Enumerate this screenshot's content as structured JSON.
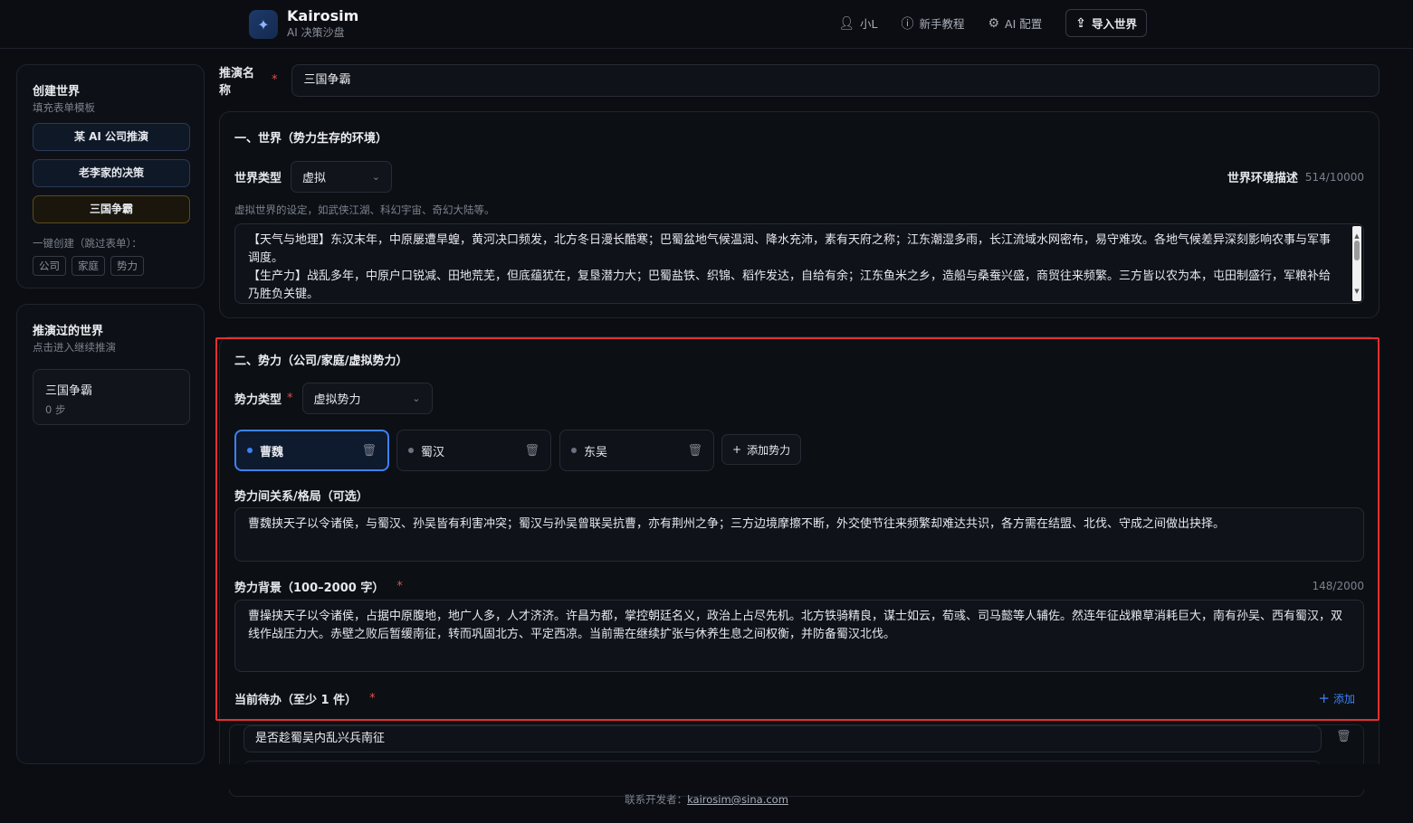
{
  "app": {
    "name": "Kairosim",
    "subtitle": "AI 决策沙盘"
  },
  "nav": {
    "user": "小L",
    "tutorial": "新手教程",
    "ai_config": "AI 配置",
    "import_world": "导入世界"
  },
  "create_card": {
    "title": "创建世界",
    "subtitle": "填充表单模板",
    "templates": [
      "某 AI 公司推演",
      "老李家的决策",
      "三国争霸"
    ],
    "quick_label": "一键创建（跳过表单）：",
    "quick_chips": [
      "公司",
      "家庭",
      "势力"
    ]
  },
  "history_card": {
    "title": "推演过的世界",
    "subtitle": "点击进入继续推演",
    "items": [
      {
        "name": "三国争霸",
        "steps": "0 步"
      }
    ]
  },
  "form": {
    "name_label": "推演名称",
    "name_value": "三国争霸",
    "world": {
      "title": "一、世界（势力生存的环境）",
      "type_label": "世界类型",
      "type_value": "虚拟",
      "env_label": "世界环境描述",
      "env_counter": "514/10000",
      "hint": "虚拟世界的设定，如武侠江湖、科幻宇宙、奇幻大陆等。",
      "env_text_1": "【天气与地理】东汉末年，中原屡遭旱蝗，黄河决口频发，北方冬日漫长酷寒；巴蜀盆地气候温润、降水充沛，素有天府之称；江东潮湿多雨，长江流域水网密布，易守难攻。各地气候差异深刻影响农事与军事调度。",
      "env_text_2": "【生产力】战乱多年，中原户口锐减、田地荒芜，但底蕴犹在，复垦潜力大；巴蜀盐铁、织锦、稻作发达，自给有余；江东鱼米之乡，造船与桑蚕兴盛，商贸往来频繁。三方皆以农为本，屯田制盛行，军粮补给乃胜负关键。"
    },
    "factions": {
      "title": "二、势力（公司/家庭/虚拟势力）",
      "type_label": "势力类型",
      "type_value": "虚拟势力",
      "list": [
        "曹魏",
        "蜀汉",
        "东吴"
      ],
      "add_label": "添加势力",
      "relation_label": "势力间关系/格局（可选）",
      "relation_text": "曹魏挟天子以令诸侯，与蜀汉、孙吴皆有利害冲突；蜀汉与孙吴曾联吴抗曹，亦有荆州之争；三方边境摩擦不断，外交使节往来频繁却难达共识，各方需在结盟、北伐、守成之间做出抉择。",
      "background_label": "势力背景（100–2000 字）",
      "background_counter": "148/2000",
      "background_text": "曹操挟天子以令诸侯，占据中原腹地，地广人多，人才济济。许昌为都，掌控朝廷名义，政治上占尽先机。北方铁骑精良，谋士如云，荀彧、司马懿等人辅佐。然连年征战粮草消耗巨大，南有孙吴、西有蜀汉，双线作战压力大。赤壁之败后暂缓南征，转而巩固北方、平定西凉。当前需在继续扩张与休养生息之间权衡，并防备蜀汉北伐。",
      "todo_label": "当前待办（至少 1 件）",
      "todo_add": "添加",
      "todos": [
        "是否趁蜀吴内乱兴兵南征"
      ]
    }
  },
  "footer": {
    "prefix": "联系开发者：",
    "email": "kairosim@sina.com"
  },
  "colors": {
    "accent": "#3b82f6",
    "highlight": "#e5302f",
    "required": "#d9534f"
  }
}
